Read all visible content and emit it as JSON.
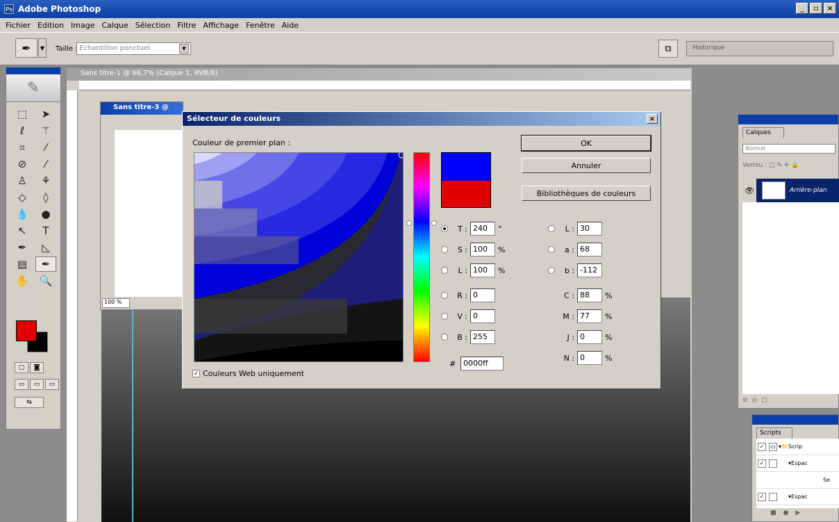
{
  "app": {
    "title": "Adobe Photoshop"
  },
  "menu": [
    "Fichier",
    "Edition",
    "Image",
    "Calque",
    "Sélection",
    "Filtre",
    "Affichage",
    "Fenêtre",
    "Aide"
  ],
  "options": {
    "size_label": "Taille :",
    "size_value": "Echantillon ponctuel",
    "history_tab": "Historique"
  },
  "doc1": {
    "title": "Sans titre-1 @ 66,7% (Calque 1, RVB/8)"
  },
  "doc3": {
    "title": "Sans titre-3 @",
    "zoom": "100 %"
  },
  "dialog": {
    "title": "Sélecteur de couleurs",
    "fg_label": "Couleur de premier plan :",
    "ok": "OK",
    "cancel": "Annuler",
    "libraries": "Bibliothèques de couleurs",
    "web_only": "Couleurs Web uniquement",
    "new_color": "#0000ff",
    "old_color": "#e00000",
    "hsb": [
      {
        "label": "T :",
        "value": "240",
        "unit": "°",
        "selected": true
      },
      {
        "label": "S :",
        "value": "100",
        "unit": "%",
        "selected": false
      },
      {
        "label": "L :",
        "value": "100",
        "unit": "%",
        "selected": false
      }
    ],
    "rgb": [
      {
        "label": "R :",
        "value": "0"
      },
      {
        "label": "V :",
        "value": "0"
      },
      {
        "label": "B :",
        "value": "255"
      }
    ],
    "hex_label": "#",
    "hex_value": "0000ff",
    "lab": [
      {
        "label": "L :",
        "value": "30"
      },
      {
        "label": "a :",
        "value": "68"
      },
      {
        "label": "b :",
        "value": "-112"
      }
    ],
    "cmyk": [
      {
        "label": "C :",
        "value": "88",
        "unit": "%"
      },
      {
        "label": "M :",
        "value": "77",
        "unit": "%"
      },
      {
        "label": "J :",
        "value": "0",
        "unit": "%"
      },
      {
        "label": "N :",
        "value": "0",
        "unit": "%"
      }
    ]
  },
  "layers": {
    "tab": "Calques",
    "mode": "Normal",
    "lock": "Verrou :",
    "layer_name": "Arrière-plan"
  },
  "scripts": {
    "tab": "Scripts",
    "rows": [
      "Scrip",
      "Espac",
      "Se",
      "Espac"
    ]
  }
}
